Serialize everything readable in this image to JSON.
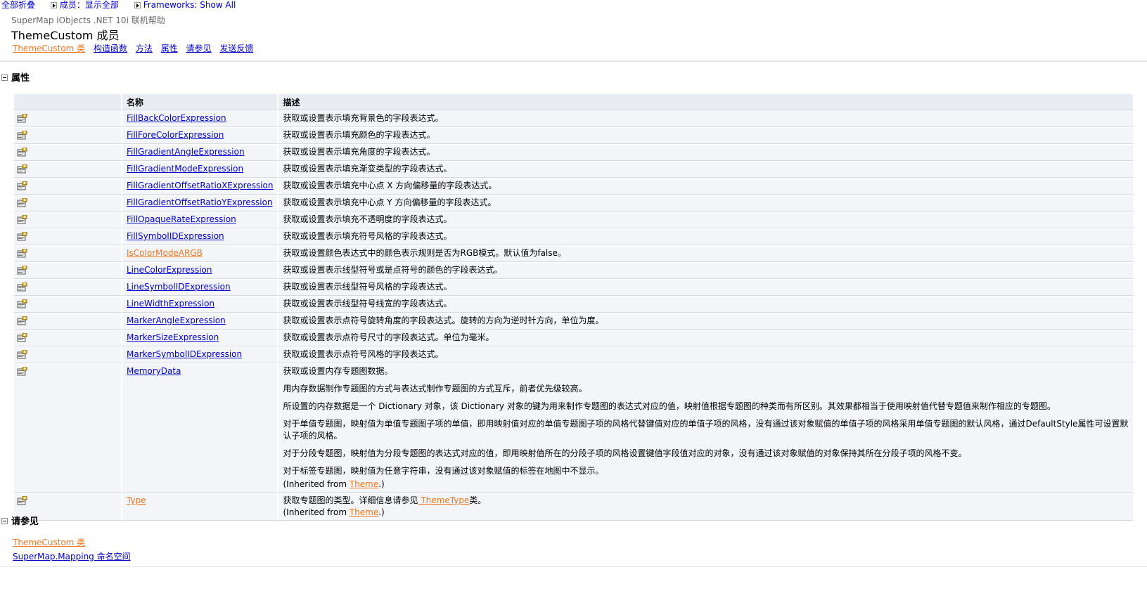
{
  "top_controls": {
    "collapse_all": "全部折叠",
    "members_filter": "成员：显示全部",
    "frameworks_filter": "Frameworks: Show All"
  },
  "header": {
    "product": "SuperMap iObjects .NET 10i 联机帮助",
    "title": "ThemeCustom 成员",
    "links": [
      {
        "label": "ThemeCustom 类",
        "visited": true
      },
      {
        "label": "构造函数",
        "visited": false
      },
      {
        "label": "方法",
        "visited": false
      },
      {
        "label": "属性",
        "visited": false
      },
      {
        "label": "请参见",
        "visited": false
      },
      {
        "label": "发送反馈",
        "visited": false
      }
    ]
  },
  "properties_section": {
    "title": "属性",
    "columns": {
      "icon": "",
      "name": "名称",
      "description": "描述"
    },
    "rows": [
      {
        "name": "FillBackColorExpression",
        "visited": false,
        "desc": [
          "获取或设置表示填充背景色的字段表达式。"
        ]
      },
      {
        "name": "FillForeColorExpression",
        "visited": false,
        "desc": [
          "获取或设置表示填充颜色的字段表达式。"
        ]
      },
      {
        "name": "FillGradientAngleExpression",
        "visited": false,
        "desc": [
          "获取或设置表示填充角度的字段表达式。"
        ]
      },
      {
        "name": "FillGradientModeExpression",
        "visited": false,
        "desc": [
          "获取或设置表示填充渐变类型的字段表达式。"
        ]
      },
      {
        "name": "FillGradientOffsetRatioXExpression",
        "visited": false,
        "desc": [
          "获取或设置表示填充中心点 X 方向偏移量的字段表达式。"
        ]
      },
      {
        "name": "FillGradientOffsetRatioYExpression",
        "visited": false,
        "desc": [
          "获取或设置表示填充中心点 Y 方向偏移量的字段表达式。"
        ]
      },
      {
        "name": "FillOpaqueRateExpression",
        "visited": false,
        "desc": [
          "获取或设置表示填充不透明度的字段表达式。"
        ]
      },
      {
        "name": "FillSymbolIDExpression",
        "visited": false,
        "desc": [
          "获取或设置表示填充符号风格的字段表达式。"
        ]
      },
      {
        "name": "IsColorModeARGB",
        "visited": true,
        "desc": [
          "获取或设置颜色表达式中的颜色表示规则是否为RGB模式。默认值为false。"
        ]
      },
      {
        "name": "LineColorExpression",
        "visited": false,
        "desc": [
          "获取或设置表示线型符号或是点符号的颜色的字段表达式。"
        ]
      },
      {
        "name": "LineSymbolIDExpression",
        "visited": false,
        "desc": [
          "获取或设置表示线型符号风格的字段表达式。"
        ]
      },
      {
        "name": "LineWidthExpression",
        "visited": false,
        "desc": [
          "获取或设置表示线型符号线宽的字段表达式。"
        ]
      },
      {
        "name": "MarkerAngleExpression",
        "visited": false,
        "desc": [
          "获取或设置表示点符号旋转角度的字段表达式。旋转的方向为逆时针方向，单位为度。"
        ]
      },
      {
        "name": "MarkerSizeExpression",
        "visited": false,
        "desc": [
          "获取或设置表示点符号尺寸的字段表达式。单位为毫米。"
        ]
      },
      {
        "name": "MarkerSymbolIDExpression",
        "visited": false,
        "desc": [
          "获取或设置表示点符号风格的字段表达式。"
        ]
      },
      {
        "name": "MemoryData",
        "visited": false,
        "desc": [
          "获取或设置内存专题图数据。",
          "用内存数据制作专题图的方式与表达式制作专题图的方式互斥，前者优先级较高。",
          "所设置的内存数据是一个 Dictionary 对象，该 Dictionary 对象的键为用来制作专题图的表达式对应的值，映射值根据专题图的种类而有所区别。其效果都相当于使用映射值代替专题值来制作相应的专题图。",
          "对于单值专题图，映射值为单值专题图子项的单值，即用映射值对应的单值专题图子项的风格代替键值对应的单值子项的风格，没有通过该对象赋值的单值子项的风格采用单值专题图的默认风格，通过DefaultStyle属性可设置默认子项的风格。",
          "对于分段专题图，映射值为分段专题图的表达式对应的值，即用映射值所在的分段子项的风格设置键值字段值对应的对象，没有通过该对象赋值的对象保持其所在分段子项的风格不变。",
          "对于标签专题图，映射值为任意字符串，没有通过该对象赋值的标签在地图中不显示。"
        ],
        "inherited": {
          "prefix": "(Inherited from ",
          "link": "Theme",
          "suffix": ".)"
        }
      },
      {
        "name": "Type",
        "visited": true,
        "desc_parts": {
          "before": "获取专题图的类型。详细信息请参见",
          "link": " ThemeType",
          "after": "类。"
        },
        "inherited": {
          "prefix": "(Inherited from ",
          "link": "Theme",
          "suffix": ".)"
        }
      }
    ]
  },
  "see_also_section": {
    "title": "请参见",
    "links": [
      {
        "label": "ThemeCustom 类",
        "visited": true
      },
      {
        "label": "SuperMap.Mapping 命名空间",
        "visited": false
      }
    ]
  },
  "colors": {
    "link": "#0000cc",
    "visited_link": "#ee7722",
    "header_row": "#e9ecf3",
    "row_bg": "#f4f5f9"
  }
}
